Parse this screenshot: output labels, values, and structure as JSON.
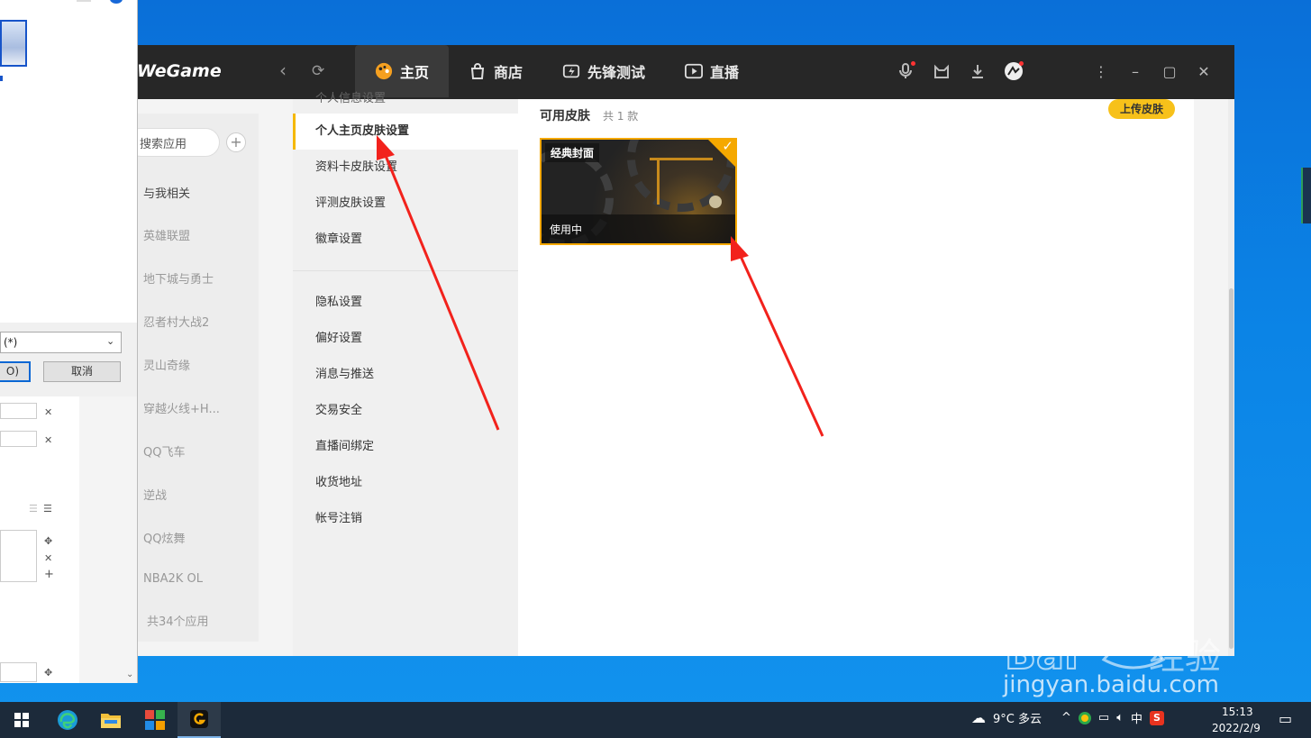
{
  "wegame": {
    "logo": "WeGame",
    "tabs": [
      {
        "label": "主页",
        "icon": "palette-icon",
        "active": true
      },
      {
        "label": "商店",
        "icon": "shopping-bag-icon",
        "active": false
      },
      {
        "label": "先锋测试",
        "icon": "lightning-icon",
        "active": false
      },
      {
        "label": "直播",
        "icon": "play-icon",
        "active": false
      }
    ],
    "top_icons": [
      "microphone-icon",
      "cat-icon",
      "download-icon",
      "avatar-icon"
    ],
    "window_controls": [
      "more-icon",
      "minimize-icon",
      "maximize-icon",
      "close-icon"
    ]
  },
  "apps_sidebar": {
    "search_placeholder": "搜索应用",
    "add_label": "+",
    "items": [
      "与我相关",
      "英雄联盟",
      "地下城与勇士",
      "忍者村大战2",
      "灵山奇缘",
      "穿越火线+H...",
      "QQ飞车",
      "逆战",
      "QQ炫舞",
      "NBA2K OL"
    ],
    "total": "共34个应用"
  },
  "settings_menu": {
    "cut_item": "个人信息设置",
    "items_group1": [
      "个人主页皮肤设置",
      "资料卡皮肤设置",
      "评测皮肤设置",
      "徽章设置"
    ],
    "items_group2": [
      "隐私设置",
      "偏好设置",
      "消息与推送",
      "交易安全",
      "直播间绑定",
      "收货地址",
      "帐号注销"
    ],
    "active": "个人主页皮肤设置"
  },
  "content": {
    "title": "可用皮肤",
    "count": "共 1 款",
    "upload_button": "上传皮肤",
    "skin": {
      "name": "经典封面",
      "status": "使用中",
      "selected": true
    }
  },
  "dialog": {
    "filter_value": "(*)",
    "ok_label": "O)",
    "cancel_label": "取消"
  },
  "taskbar": {
    "apps": [
      "windows-start-icon",
      "edge-icon",
      "file-explorer-icon",
      "app-store-icon",
      "wegame-icon"
    ],
    "weather": "9°C 多云",
    "ime": "中",
    "time": "15:13",
    "date": "2022/2/9"
  },
  "watermark": {
    "text": "jingyan.baidu.com",
    "brand": "Baidu经验"
  },
  "colors": {
    "accent": "#f5b800",
    "topbar": "#272727",
    "arrow": "#f2221c"
  }
}
